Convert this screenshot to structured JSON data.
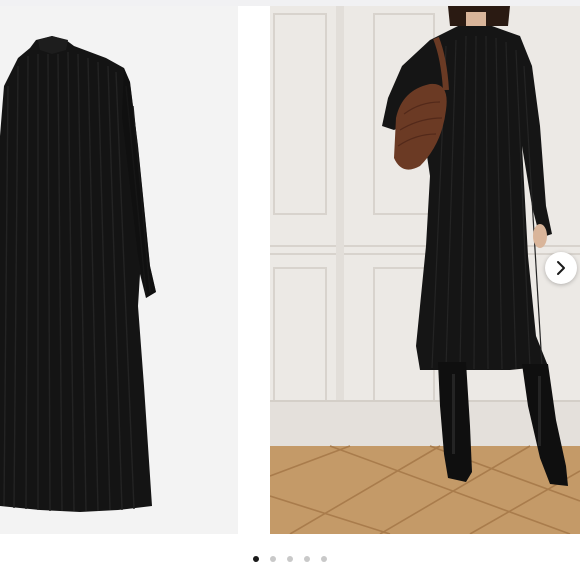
{
  "carousel": {
    "slides": [
      {
        "image": "dress-flat-lay-photo",
        "background_color": "#f3f3f3"
      },
      {
        "image": "model-wearing-dress-photo",
        "background_color": "#ebe8e4"
      }
    ],
    "next_icon": "chevron-right-icon",
    "pagination": {
      "count": 5,
      "active_index": 0,
      "active_color": "#1a1a1a",
      "inactive_color": "#c9c9c9"
    }
  }
}
